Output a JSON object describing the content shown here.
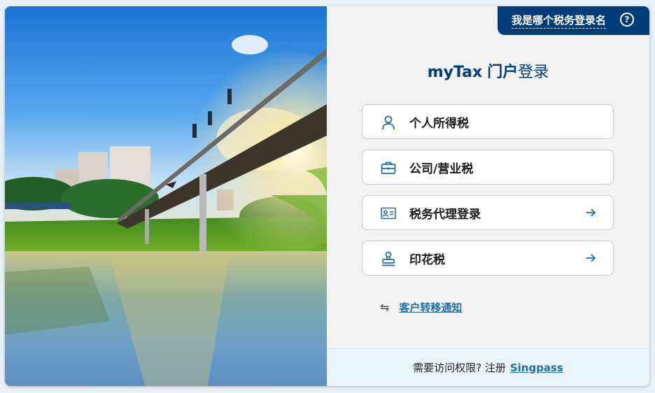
{
  "header": {
    "which_login_label": "我是哪个税务登录名",
    "help_icon": "?"
  },
  "title": {
    "brand": "myTax",
    "portal": "门户",
    "login": "登录"
  },
  "login_options": [
    {
      "label": "个人所得税",
      "icon": "person-icon",
      "has_arrow": false
    },
    {
      "label": "公司/营业税",
      "icon": "briefcase-icon",
      "has_arrow": false
    },
    {
      "label": "税务代理登录",
      "icon": "id-card-icon",
      "has_arrow": true
    },
    {
      "label": "印花税",
      "icon": "stamp-icon",
      "has_arrow": true
    }
  ],
  "transfer": {
    "icon": "⇋",
    "link_text": "客户转移通知"
  },
  "footer": {
    "text": "需要访问权限? 注册",
    "link_text": "Singpass"
  },
  "colors": {
    "primary": "#003c7a",
    "icon_blue": "#1f6fa8",
    "panel_bg": "#f2f2f2",
    "footer_bg": "#eaf4fb"
  }
}
